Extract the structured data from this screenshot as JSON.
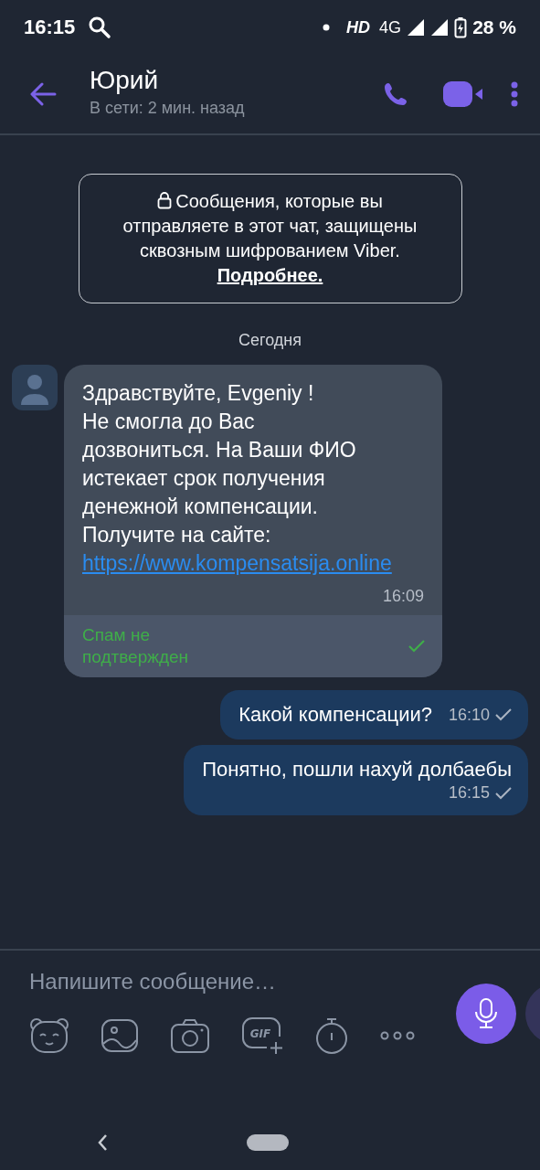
{
  "status_bar": {
    "time": "16:15",
    "network_label": "HD",
    "network_type": "4G",
    "battery": "28 %",
    "charging": true
  },
  "header": {
    "title": "Юрий",
    "subtitle": "В сети: 2 мин. назад"
  },
  "encryption_notice": {
    "text": "Сообщения, которые вы отправляете в этот чат, защищены сквозным шифрованием Viber. **Подробнее.**"
  },
  "date_separator": "Сегодня",
  "messages": [
    {
      "kind": "incoming",
      "text": "Здравствуйте, Evgeniy !\nНе смогла до Вас\nдозвониться. На Ваши ФИО\nистекает срок получения\nденежной компенсации.\nПолучите на сайте:",
      "link": "https://www.kompensatsija.online",
      "time": "16:09",
      "spam_label": "Спам не подтвержден",
      "spam_checked": true
    },
    {
      "kind": "outgoing",
      "text": "Какой компенсации?",
      "time": "16:10",
      "delivered": true
    },
    {
      "kind": "outgoing",
      "text": "Понятно, пошли нахуй долбаебы",
      "time": "16:15",
      "delivered": true
    }
  ],
  "composer": {
    "placeholder": "Напишите сообщение…",
    "gif_label": "GIF"
  }
}
